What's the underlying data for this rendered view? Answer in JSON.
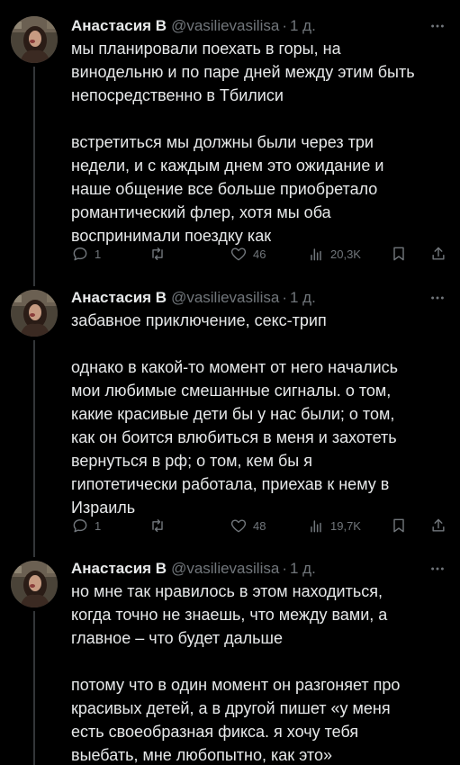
{
  "tweets": [
    {
      "author": "Анастасия В",
      "handle": "@vasilievasilisa",
      "separator": "·",
      "time": "1 д.",
      "paragraphs": [
        "мы планировали поехать в горы, на\nвинодельню и по паре дней между этим быть\nнепосредственно в Тбилиси",
        "встретиться мы должны были через три\nнедели, и с каждым днем это ожидание и\nнаше общение все больше приобретало\nромантический флер, хотя мы оба\nвоспринимали поездку как"
      ],
      "stats": {
        "replies": "1",
        "retweets": "",
        "likes": "46",
        "views": "20,3K"
      }
    },
    {
      "author": "Анастасия В",
      "handle": "@vasilievasilisa",
      "separator": "·",
      "time": "1 д.",
      "paragraphs": [
        "забавное приключение, секс-трип",
        "однако в какой-то момент от него начались\nмои любимые смешанные сигналы. о том,\nкакие красивые дети бы у нас были; о том,\nкак он боится влюбиться в меня и захотеть\nвернуться в рф; о том, кем бы я\nгипотетически работала, приехав к нему в\nИзраиль"
      ],
      "stats": {
        "replies": "1",
        "retweets": "",
        "likes": "48",
        "views": "19,7K"
      }
    },
    {
      "author": "Анастасия В",
      "handle": "@vasilievasilisa",
      "separator": "·",
      "time": "1 д.",
      "paragraphs": [
        "но мне так нравилось в этом находиться,\nкогда точно не знаешь, что между вами, а\nглавное – что будет дальше",
        "потому что в один момент он разгоняет про\nкрасивых детей, а в другой пишет «у меня\nесть своеобразная фикса. я хочу тебя\nвыебать, мне любопытно, как это»"
      ]
    }
  ],
  "icons": {
    "more": "more-dots-icon",
    "reply": "reply-bubble-icon",
    "retweet": "retweet-arrows-icon",
    "like": "heart-icon",
    "views": "bar-chart-icon",
    "bookmark": "bookmark-icon",
    "share": "share-upload-icon"
  },
  "colors": {
    "background": "#000000",
    "text": "#e7e9ea",
    "muted": "#71767b",
    "thread_line": "#333639"
  }
}
